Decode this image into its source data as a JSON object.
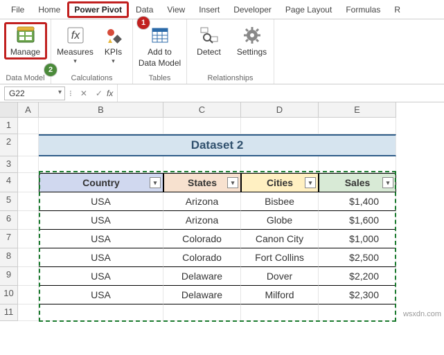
{
  "tabs": [
    "File",
    "Home",
    "Power Pivot",
    "Data",
    "View",
    "Insert",
    "Developer",
    "Page Layout",
    "Formulas",
    "R"
  ],
  "active_tab": "Power Pivot",
  "ribbon": {
    "manage": "Manage",
    "measures": "Measures",
    "kpis": "KPIs",
    "add_to_dm_l1": "Add to",
    "add_to_dm_l2": "Data Model",
    "detect": "Detect",
    "settings": "Settings",
    "grp_data_model": "Data Model",
    "grp_calculations": "Calculations",
    "grp_tables": "Tables",
    "grp_relationships": "Relationships"
  },
  "annotations": {
    "one": "1",
    "two": "2"
  },
  "namebox": "G22",
  "fx": "fx",
  "columns": [
    "A",
    "B",
    "C",
    "D",
    "E"
  ],
  "rows": [
    "1",
    "2",
    "3",
    "4",
    "5",
    "6",
    "7",
    "8",
    "9",
    "10",
    "11"
  ],
  "dataset_title": "Dataset 2",
  "headers": {
    "country": "Country",
    "states": "States",
    "cities": "Cities",
    "sales": "Sales"
  },
  "header_colors": {
    "country": "#d0d8ef",
    "states": "#f7e1cf",
    "cities": "#fff0c2",
    "sales": "#d8ead6"
  },
  "table": [
    {
      "country": "USA",
      "states": "Arizona",
      "cities": "Bisbee",
      "sales": "$1,400"
    },
    {
      "country": "USA",
      "states": "Arizona",
      "cities": "Globe",
      "sales": "$1,600"
    },
    {
      "country": "USA",
      "states": "Colorado",
      "cities": "Canon City",
      "sales": "$1,000"
    },
    {
      "country": "USA",
      "states": "Colorado",
      "cities": "Fort Collins",
      "sales": "$2,500"
    },
    {
      "country": "USA",
      "states": "Delaware",
      "cities": "Dover",
      "sales": "$2,200"
    },
    {
      "country": "USA",
      "states": "Delaware",
      "cities": "Milford",
      "sales": "$2,300"
    }
  ],
  "watermark": "wsxdn.com"
}
